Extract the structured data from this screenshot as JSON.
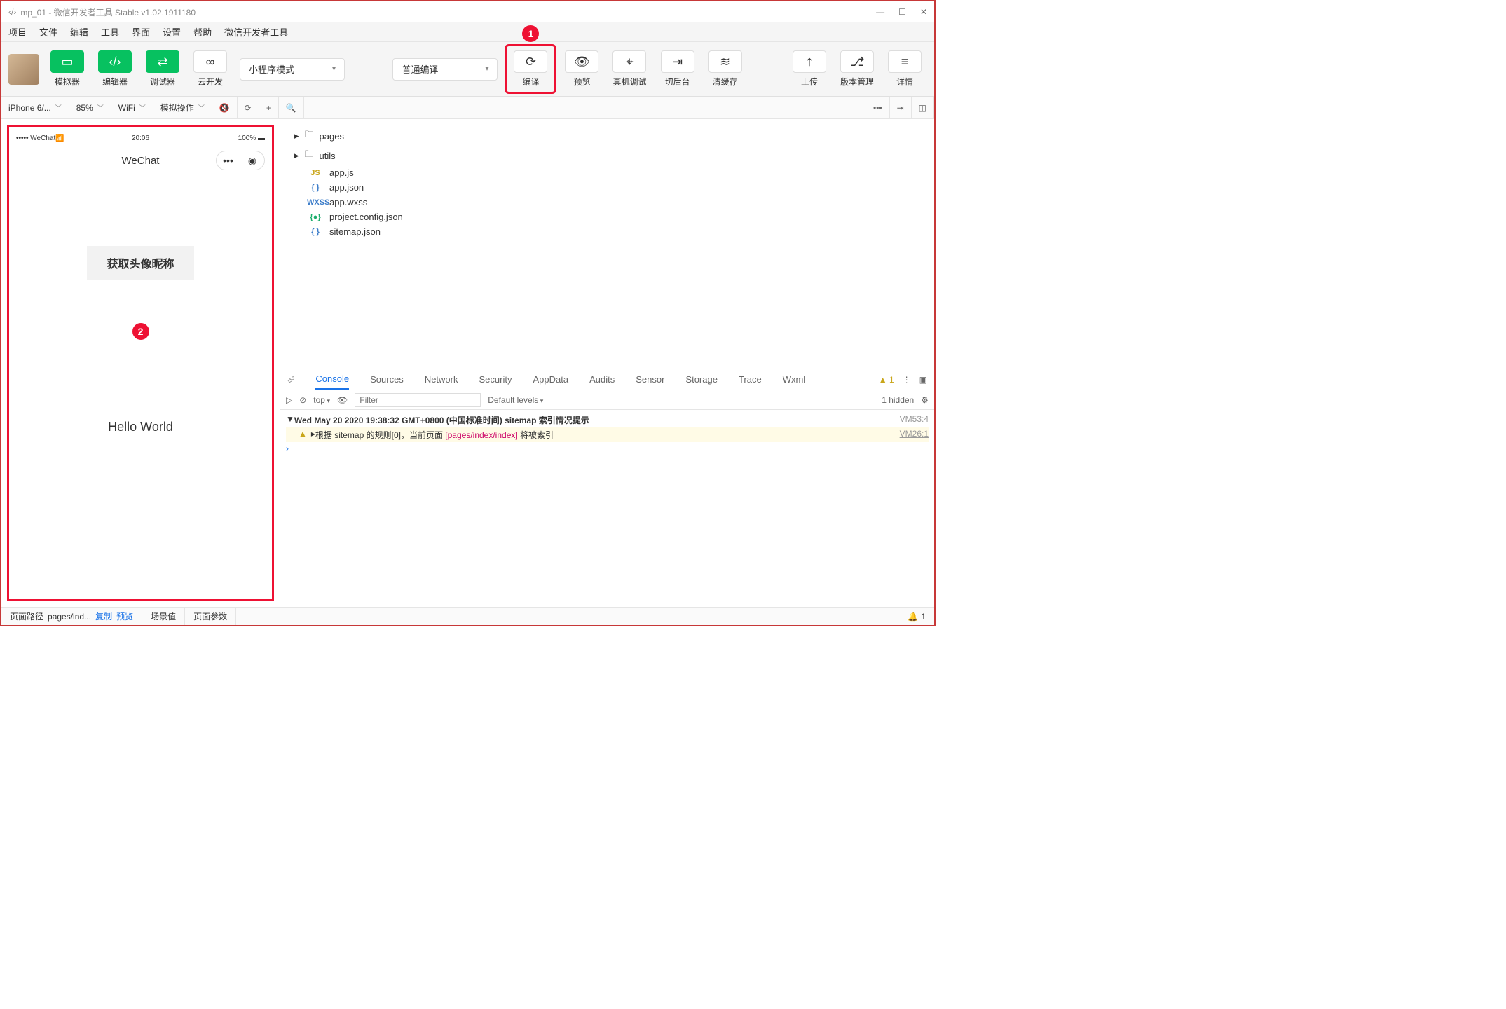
{
  "window": {
    "title": "mp_01 - 微信开发者工具 Stable v1.02.1911180"
  },
  "menu": [
    "项目",
    "文件",
    "编辑",
    "工具",
    "界面",
    "设置",
    "帮助",
    "微信开发者工具"
  ],
  "toolbar": {
    "simulator": "模拟器",
    "editor": "编辑器",
    "debugger": "调试器",
    "cloud": "云开发",
    "mode_select": "小程序模式",
    "compile_select": "普通编译",
    "compile": "编译",
    "preview": "预览",
    "remote": "真机调试",
    "background": "切后台",
    "clearcache": "清缓存",
    "upload": "上传",
    "version": "版本管理",
    "details": "详情"
  },
  "simbar": {
    "device": "iPhone 6/...",
    "zoom": "85%",
    "network": "WiFi",
    "mock": "模拟操作"
  },
  "simulator": {
    "carrier": "WeChat",
    "time": "20:06",
    "battery": "100%",
    "navtitle": "WeChat",
    "btn_avatar": "获取头像昵称",
    "hello": "Hello World"
  },
  "filetree": {
    "pages": "pages",
    "utils": "utils",
    "appjs": "app.js",
    "appjson": "app.json",
    "appwxss": "app.wxss",
    "projectconfig": "project.config.json",
    "sitemap": "sitemap.json"
  },
  "devtools": {
    "tabs": [
      "Console",
      "Sources",
      "Network",
      "Security",
      "AppData",
      "Audits",
      "Sensor",
      "Storage",
      "Trace",
      "Wxml"
    ],
    "warn_count": "1",
    "context": "top",
    "filter_placeholder": "Filter",
    "levels": "Default levels",
    "hidden": "1 hidden",
    "log1": "Wed May 20 2020 19:38:32 GMT+0800 (中国标准时间) sitemap 索引情况提示",
    "log1_src": "VM53:4",
    "log2_pre": "根据 sitemap 的规则[0]，当前页面 ",
    "log2_path": "[pages/index/index]",
    "log2_post": " 将被索引",
    "log2_src": "VM26:1"
  },
  "footer": {
    "page_path_label": "页面路径",
    "page_path_value": "pages/ind...",
    "copy": "复制",
    "preview": "预览",
    "scene": "场景值",
    "params": "页面参数",
    "notif": "1"
  }
}
